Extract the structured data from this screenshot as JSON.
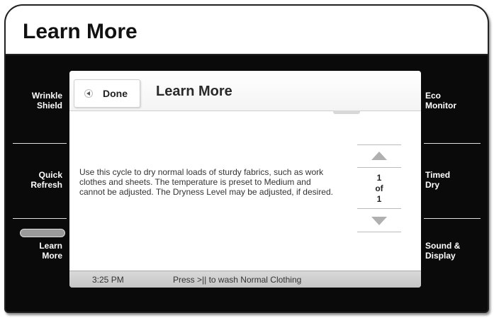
{
  "header": {
    "title": "Learn More"
  },
  "left_menu": [
    {
      "label": "Wrinkle\nShield"
    },
    {
      "label": "Quick\nRefresh"
    },
    {
      "label": "Learn\nMore",
      "selected": true
    }
  ],
  "right_menu": [
    {
      "label": "Eco\nMonitor"
    },
    {
      "label": "Timed\nDry"
    },
    {
      "label": "Sound &\nDisplay"
    }
  ],
  "dialog": {
    "done_label": "Done",
    "title": "Learn More",
    "body": "Use this cycle to dry normal loads of sturdy fabrics, such as work clothes and sheets. The temperature is preset to Medium and cannot be adjusted. The Dryness Level may be adjusted, if desired.",
    "pager": {
      "current": "1",
      "of_label": "of",
      "total": "1"
    }
  },
  "status": {
    "time": "3:25 PM",
    "message": "Press >|| to wash Normal Clothing"
  },
  "colors": {
    "frame": "#0a0a0a",
    "dialog_bg": "#ffffff",
    "status_bar": "#cccccc"
  }
}
